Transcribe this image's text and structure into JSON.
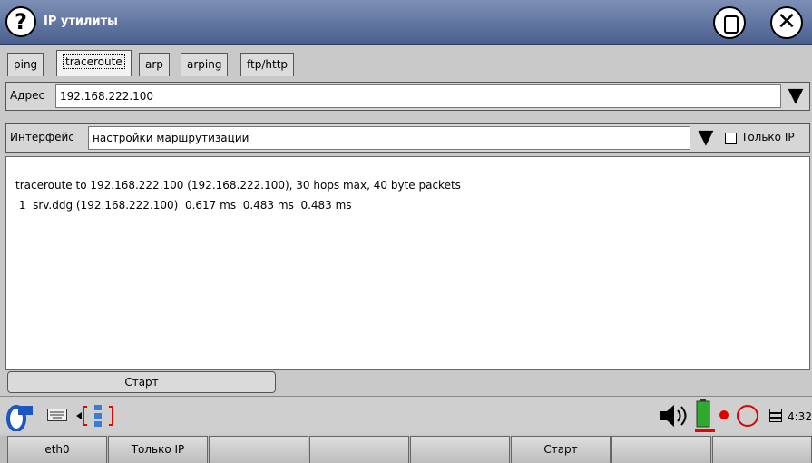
{
  "window": {
    "title": "IP утилиты"
  },
  "tabs": [
    {
      "label": "ping"
    },
    {
      "label": "traceroute"
    },
    {
      "label": "arp"
    },
    {
      "label": "arping"
    },
    {
      "label": "ftp/http"
    }
  ],
  "address": {
    "label": "Адрес",
    "value": "192.168.222.100"
  },
  "interface": {
    "label": "Интерфейс",
    "value": "настройки маршрутизации",
    "ip_only_label": "Только IP"
  },
  "output": {
    "lines": [
      "traceroute to 192.168.222.100 (192.168.222.100), 30 hops max, 40 byte packets",
      " 1  srv.ddg (192.168.222.100)  0.617 ms  0.483 ms  0.483 ms"
    ]
  },
  "start_button": "Старт",
  "tray": {
    "clock": "4:32"
  },
  "softkeys": [
    "eth0",
    "Только IP",
    "",
    "",
    "",
    "Старт",
    "",
    ""
  ],
  "colors": {
    "titlebar": "#5a6d9b",
    "battery": "#2faa2f",
    "record": "#e00000"
  }
}
